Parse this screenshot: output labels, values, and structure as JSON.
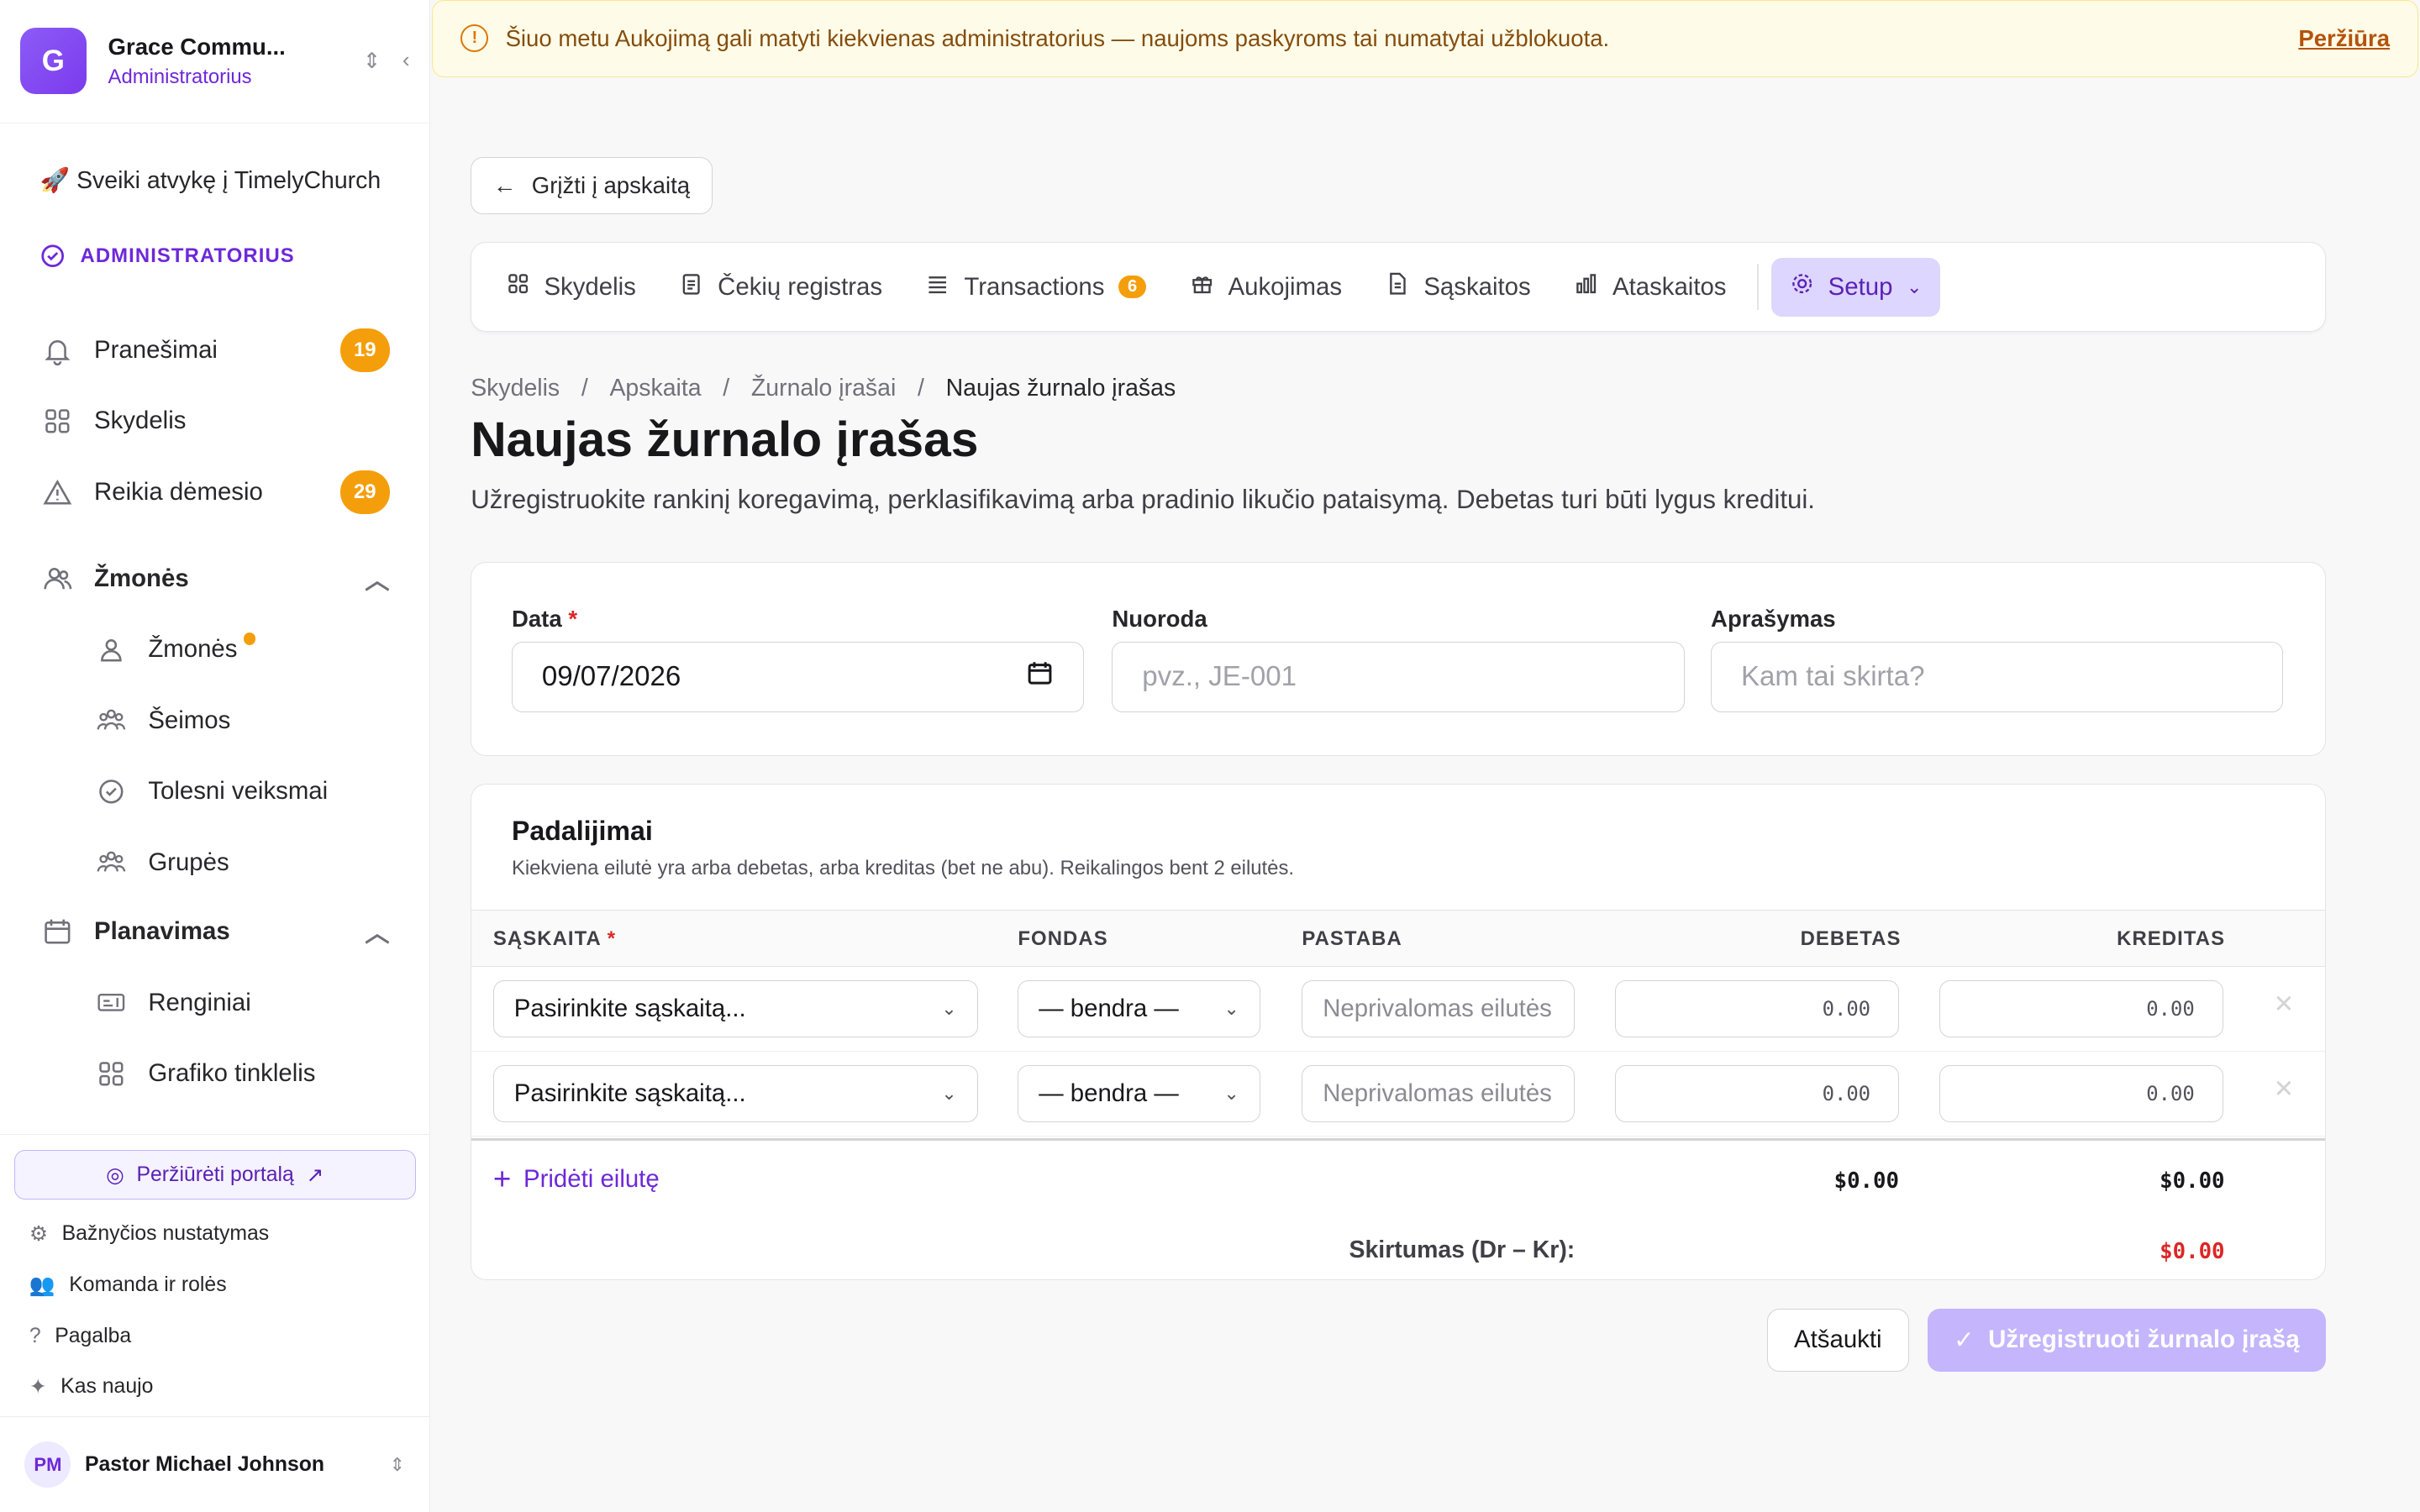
{
  "org": {
    "initial": "G",
    "name": "Grace Commu...",
    "role": "Administratorius"
  },
  "welcome": "🚀 Sveiki atvykę į TimelyChurch",
  "section_label": "ADMINISTRATORIUS",
  "nav": {
    "notifications": {
      "label": "Pranešimai",
      "badge": "19"
    },
    "dashboard": {
      "label": "Skydelis"
    },
    "attention": {
      "label": "Reikia dėmesio",
      "badge": "29"
    },
    "people_group": {
      "label": "Žmonės"
    },
    "people": {
      "label": "Žmonės"
    },
    "families": {
      "label": "Šeimos"
    },
    "followups": {
      "label": "Tolesni veiksmai"
    },
    "groups": {
      "label": "Grupės"
    },
    "planning_group": {
      "label": "Planavimas"
    },
    "events": {
      "label": "Renginiai"
    },
    "schedule_grid": {
      "label": "Grafiko tinklelis"
    }
  },
  "bottom": {
    "portal": "Peržiūrėti portalą",
    "church_settings": "Bažnyčios nustatymas",
    "team_roles": "Komanda ir rolės",
    "help": "Pagalba",
    "whats_new": "Kas naujo"
  },
  "user": {
    "initials": "PM",
    "name": "Pastor Michael Johnson"
  },
  "alert": {
    "text": "Šiuo metu Aukojimą gali matyti kiekvienas administratorius — naujoms paskyroms tai numatytai užblokuota.",
    "link": "Peržiūra"
  },
  "back_button": "Grįžti į apskaitą",
  "tabs": [
    {
      "label": "Skydelis"
    },
    {
      "label": "Čekių registras"
    },
    {
      "label": "Transactions",
      "badge": "6"
    },
    {
      "label": "Aukojimas"
    },
    {
      "label": "Sąskaitos"
    },
    {
      "label": "Ataskaitos"
    },
    {
      "label": "Setup"
    }
  ],
  "breadcrumb": [
    "Skydelis",
    "Apskaita",
    "Žurnalo įrašai",
    "Naujas žurnalo įrašas"
  ],
  "page": {
    "title": "Naujas žurnalo įrašas",
    "subtitle": "Užregistruokite rankinį koregavimą, perklasifikavimą arba pradinio likučio pataisymą. Debetas turi būti lygus kreditui."
  },
  "form": {
    "date_label": "Data",
    "date_value": "09/07/2026",
    "ref_label": "Nuoroda",
    "ref_placeholder": "pvz., JE-001",
    "desc_label": "Aprašymas",
    "desc_placeholder": "Kam tai skirta?"
  },
  "splits": {
    "title": "Padalijimai",
    "hint": "Kiekviena eilutė yra arba debetas, arba kreditas (bet ne abu). Reikalingos bent 2 eilutės.",
    "columns": {
      "account": "SĄSKAITA",
      "fund": "FONDAS",
      "memo": "PASTABA",
      "debit": "DEBETAS",
      "credit": "KREDITAS"
    },
    "rows": [
      {
        "account": "Pasirinkite sąskaitą...",
        "fund": "— bendra —",
        "memo_placeholder": "Neprivalomas eilutės",
        "debit": "0.00",
        "credit": "0.00"
      },
      {
        "account": "Pasirinkite sąskaitą...",
        "fund": "— bendra —",
        "memo_placeholder": "Neprivalomas eilutės",
        "debit": "0.00",
        "credit": "0.00"
      }
    ],
    "add_row": "Pridėti eilutę",
    "total_debit": "$0.00",
    "total_credit": "$0.00",
    "diff_label": "Skirtumas (Dr – Kr):",
    "diff_value": "$0.00"
  },
  "actions": {
    "cancel": "Atšaukti",
    "submit": "Užregistruoti žurnalo įrašą"
  },
  "colors": {
    "accent": "#6d28d9",
    "badge": "#f59e0b",
    "danger": "#dc2626"
  }
}
